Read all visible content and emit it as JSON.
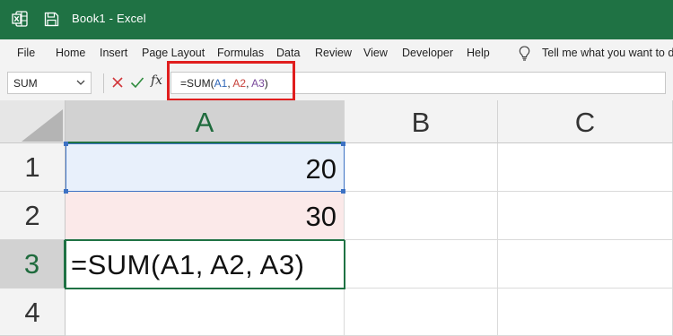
{
  "window": {
    "title": "Book1  -  Excel"
  },
  "icons": {
    "app": "excel-icon",
    "save": "save-icon",
    "bulb": "lightbulb-icon",
    "cancel": "cancel-x-icon",
    "enter": "checkmark-icon",
    "fx": "fx-icon"
  },
  "menu": {
    "items": [
      "File",
      "Home",
      "Insert",
      "Page Layout",
      "Formulas",
      "Data",
      "Review",
      "View",
      "Developer",
      "Help"
    ],
    "tell_me": "Tell me what you want to d"
  },
  "formula_bar": {
    "name_box": "SUM",
    "fx": "fx",
    "formula_parts": {
      "prefix": "=SUM(",
      "a1": "A1",
      "sep1": ", ",
      "a2": "A2",
      "sep2": ", ",
      "a3": "A3",
      "suffix": ")"
    }
  },
  "sheet": {
    "columns": [
      "A",
      "B",
      "C"
    ],
    "rows": [
      "1",
      "2",
      "3",
      "4"
    ],
    "cells": {
      "A1": "20",
      "A2": "30",
      "A3": "=SUM(A1, A2, A3)"
    }
  },
  "colors": {
    "title_bar": "#1f7244",
    "ref_a1": "#2f66b7",
    "ref_a2": "#c8423b",
    "ref_a3": "#7a4a9c",
    "highlight": "#e01e1e"
  }
}
